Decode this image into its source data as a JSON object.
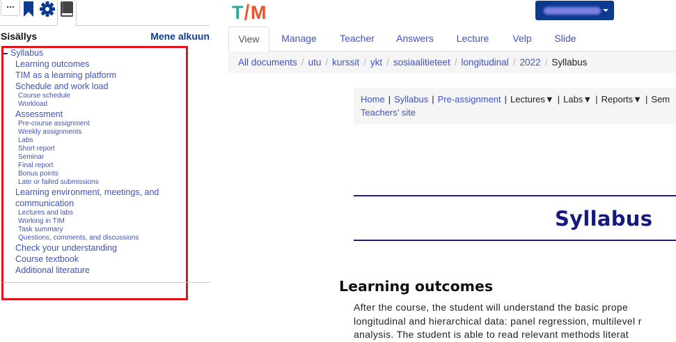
{
  "sidebar": {
    "menu_label": "...",
    "toc_title": "Sisällys",
    "top_link": "Mene alkuun",
    "toc": [
      {
        "level": 1,
        "label": "Syllabus"
      },
      {
        "level": 2,
        "label": "Learning outcomes"
      },
      {
        "level": 2,
        "label": "TIM as a learning platform"
      },
      {
        "level": 2,
        "label": "Schedule and work load"
      },
      {
        "level": 3,
        "label": "Course schedule"
      },
      {
        "level": 3,
        "label": "Workload"
      },
      {
        "level": 2,
        "label": "Assessment"
      },
      {
        "level": 3,
        "label": "Pre-course assignment"
      },
      {
        "level": 3,
        "label": "Weekly assignments"
      },
      {
        "level": 3,
        "label": "Labs"
      },
      {
        "level": 3,
        "label": "Short report"
      },
      {
        "level": 3,
        "label": "Seminar"
      },
      {
        "level": 3,
        "label": "Final report"
      },
      {
        "level": 3,
        "label": "Bonus points"
      },
      {
        "level": 3,
        "label": "Late or failed submissions"
      },
      {
        "level": 2,
        "label": "Learning environment, meetings, and communication"
      },
      {
        "level": 3,
        "label": "Lectures and labs"
      },
      {
        "level": 3,
        "label": "Working in TIM"
      },
      {
        "level": 3,
        "label": "Task summary"
      },
      {
        "level": 3,
        "label": "Questions, comments, and discussions"
      },
      {
        "level": 2,
        "label": "Check your understanding"
      },
      {
        "level": 2,
        "label": "Course textbook"
      },
      {
        "level": 2,
        "label": "Additional literature"
      }
    ]
  },
  "header": {
    "logo_text": "TIM"
  },
  "tabs": [
    "View",
    "Manage",
    "Teacher",
    "Answers",
    "Lecture",
    "Velp",
    "Slide"
  ],
  "breadcrumbs": [
    "All documents",
    "utu",
    "kurssit",
    "ykt",
    "sosiaalitieteet",
    "longitudinal",
    "2022",
    "Syllabus"
  ],
  "course_nav": {
    "links": [
      "Home",
      "Syllabus",
      "Pre-assignment",
      "Lectures▼",
      "Labs▼",
      "Reports▼",
      "Sem"
    ],
    "second_row": "Teachers’ site"
  },
  "content": {
    "title": "Syllabus",
    "section_heading": "Learning outcomes",
    "paragraph_lines": [
      "After the course, the student will understand the basic prope",
      "longitudinal and hierarchical data: panel regression, multilevel r",
      "analysis. The student is able to read relevant methods literat"
    ]
  },
  "colors": {
    "link": "#3d52c2",
    "brand_navy": "#0b3a8f",
    "highlight_red": "#e0141b",
    "title_navy": "#161a7a"
  }
}
